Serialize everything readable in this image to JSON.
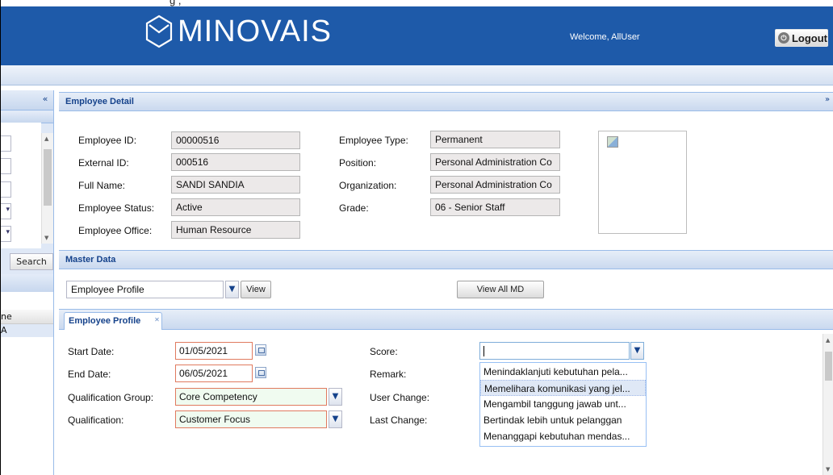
{
  "top_strip_text": "g                              ,",
  "header": {
    "brand": "MINOVAIS",
    "welcome": "Welcome, AllUser",
    "logout_label": "Logout",
    "bg_color": "#1e5aa9"
  },
  "left_panel": {
    "search_label": "Search",
    "grid_col": "ne",
    "grid_cell": "A",
    "collapse_icon": "«"
  },
  "employee_detail": {
    "title": "Employee Detail",
    "fields": {
      "employee_id": {
        "label": "Employee ID:",
        "value": "00000516"
      },
      "external_id": {
        "label": "External ID:",
        "value": "000516"
      },
      "full_name": {
        "label": "Full Name:",
        "value": "SANDI SANDIA"
      },
      "employee_status": {
        "label": "Employee Status:",
        "value": "Active"
      },
      "employee_office": {
        "label": "Employee Office:",
        "value": "Human Resource"
      },
      "employee_type": {
        "label": "Employee Type:",
        "value": "Permanent"
      },
      "position": {
        "label": "Position:",
        "value": "Personal Administration Co"
      },
      "organization": {
        "label": "Organization:",
        "value": "Personal Administration Co"
      },
      "grade": {
        "label": "Grade:",
        "value": "06 - Senior Staff"
      }
    }
  },
  "master_data": {
    "title": "Master Data",
    "selected": "Employee Profile",
    "view_label": "View",
    "view_all_label": "View All MD"
  },
  "profile_tab": {
    "tab_label": "Employee Profile",
    "start_date": {
      "label": "Start Date:",
      "value": "01/05/2021"
    },
    "end_date": {
      "label": "End Date:",
      "value": "06/05/2021"
    },
    "qualification_group": {
      "label": "Qualification Group:",
      "value": "Core Competency"
    },
    "qualification": {
      "label": "Qualification:",
      "value": "Customer Focus"
    },
    "score_label": "Score:",
    "remark_label": "Remark:",
    "user_change_label": "User Change:",
    "last_change_label": "Last Change:",
    "score_options": [
      "Menindaklanjuti kebutuhan pela...",
      "Memelihara komunikasi yang jel...",
      "Mengambil tanggung jawab unt...",
      "Bertindak lebih untuk pelanggan",
      "Menanggapi kebutuhan mendas..."
    ]
  }
}
